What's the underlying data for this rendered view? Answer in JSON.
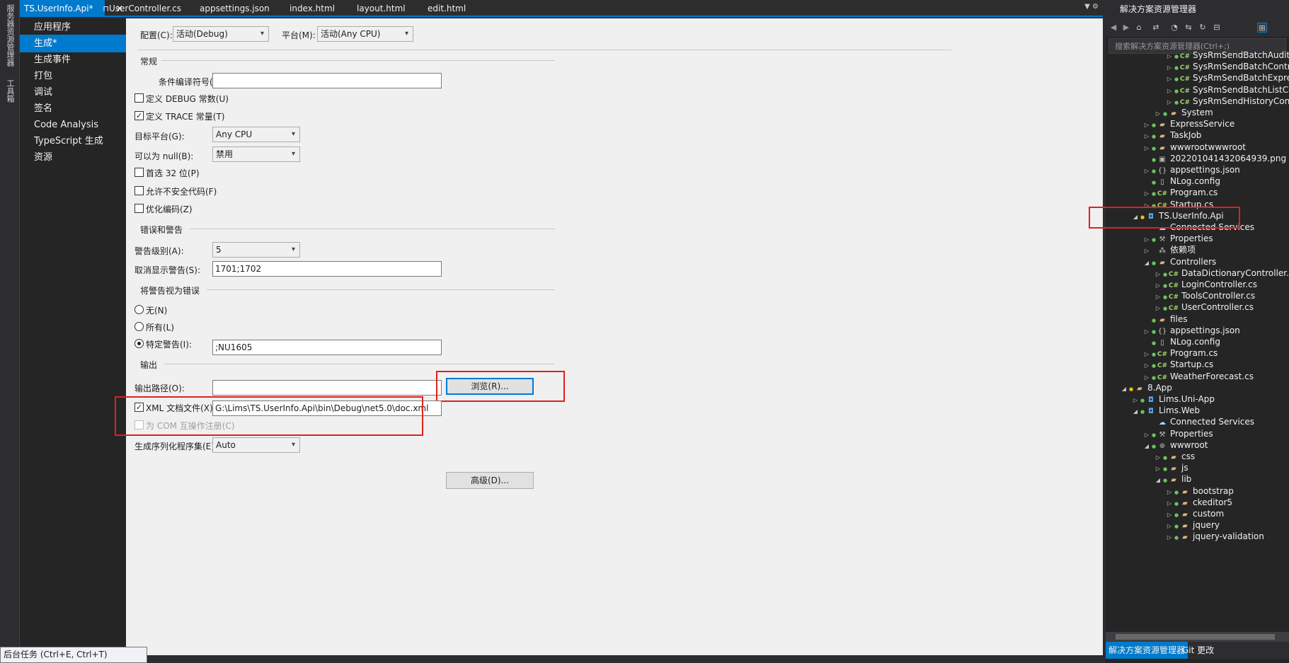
{
  "left_strip": {
    "items": [
      "服务器资源管理器",
      "工具箱"
    ]
  },
  "tabs": [
    {
      "label": "TS.UserInfo.Api*",
      "active": true,
      "pin": "⊓",
      "close": "✕"
    },
    {
      "label": "UserController.cs"
    },
    {
      "label": "appsettings.json"
    },
    {
      "label": "index.html"
    },
    {
      "label": "layout.html"
    },
    {
      "label": "edit.html"
    }
  ],
  "nav": {
    "items": [
      "应用程序",
      "生成*",
      "生成事件",
      "打包",
      "调试",
      "签名",
      "Code Analysis",
      "TypeScript 生成",
      "资源"
    ],
    "selected_index": 1
  },
  "config": {
    "label": "配置(C):",
    "value": "活动(Debug)",
    "platform_label": "平台(M):",
    "platform_value": "活动(Any CPU)"
  },
  "general": {
    "section": "常规",
    "conditional_label": "条件编译符号(Y):",
    "conditional_value": "",
    "define_debug": {
      "label": "定义 DEBUG 常数(U)",
      "checked": false
    },
    "define_trace": {
      "label": "定义 TRACE 常量(T)",
      "checked": true
    },
    "target_label": "目标平台(G):",
    "target_value": "Any CPU",
    "nullable_label": "可以为 null(B):",
    "nullable_value": "禁用",
    "prefer32": {
      "label": "首选 32 位(P)",
      "checked": false
    },
    "unsafe": {
      "label": "允许不安全代码(F)",
      "checked": false
    },
    "optimize": {
      "label": "优化编码(Z)",
      "checked": false
    }
  },
  "errors": {
    "section": "错误和警告",
    "level_label": "警告级别(A):",
    "level_value": "5",
    "suppress_label": "取消显示警告(S):",
    "suppress_value": "1701;1702"
  },
  "treat": {
    "section": "将警告视为错误",
    "none_label": "无(N)",
    "all_label": "所有(L)",
    "specific_label": "特定警告(I):",
    "specific_value": ";NU1605",
    "selected": "specific"
  },
  "output": {
    "section": "输出",
    "path_label": "输出路径(O):",
    "path_value": "",
    "browse_label": "浏览(R)...",
    "xml_label": "XML 文档文件(X):",
    "xml_checked": true,
    "xml_value": "G:\\Lims\\TS.UserInfo.Api\\bin\\Debug\\net5.0\\doc.xml",
    "com_label": "为 COM 互操作注册(C)",
    "com_checked": false,
    "serialization_label": "生成序列化程序集(E):",
    "serialization_value": "Auto",
    "advanced_label": "高级(D)..."
  },
  "solution_explorer": {
    "title": "解决方案资源管理器",
    "search_placeholder": "搜索解决方案资源管理器(Ctrl+;)",
    "tree": [
      {
        "text": "SysRmSendBatchAuditCo",
        "indent": 4,
        "icon": "cs",
        "expander": "right",
        "status": "g"
      },
      {
        "text": "SysRmSendBatchControl",
        "indent": 4,
        "icon": "cs",
        "expander": "right",
        "status": "g"
      },
      {
        "text": "SysRmSendBatchExpress",
        "indent": 4,
        "icon": "cs",
        "expander": "right",
        "status": "g"
      },
      {
        "text": "SysRmSendBatchListCont",
        "indent": 4,
        "icon": "cs",
        "expander": "right",
        "status": "g"
      },
      {
        "text": "SysRmSendHistoryContro",
        "indent": 4,
        "icon": "cs",
        "expander": "right",
        "status": "g"
      },
      {
        "text": "System",
        "indent": 3,
        "icon": "folder",
        "expander": "right",
        "status": "g"
      },
      {
        "text": "ExpressService",
        "indent": 2,
        "icon": "folder",
        "expander": "right",
        "status": "g"
      },
      {
        "text": "TaskJob",
        "indent": 2,
        "icon": "folder",
        "expander": "right",
        "status": "g"
      },
      {
        "text": "wwwrootwwwroot",
        "indent": 2,
        "icon": "folder",
        "expander": "right",
        "status": "g"
      },
      {
        "text": "202201041432064939.png",
        "indent": 2,
        "icon": "img",
        "expander": "",
        "status": "g"
      },
      {
        "text": "appsettings.json",
        "indent": 2,
        "icon": "json",
        "expander": "right",
        "status": "g"
      },
      {
        "text": "NLog.config",
        "indent": 2,
        "icon": "cfg",
        "expander": "",
        "status": "g"
      },
      {
        "text": "Program.cs",
        "indent": 2,
        "icon": "cs",
        "expander": "right",
        "status": "g"
      },
      {
        "text": "Startup.cs",
        "indent": 2,
        "icon": "cs",
        "expander": "right",
        "status": "g"
      },
      {
        "text": "TS.UserInfo.Api",
        "indent": 1,
        "icon": "proj",
        "expander": "down",
        "status": "y"
      },
      {
        "text": "Connected Services",
        "indent": 2,
        "icon": "svc",
        "expander": "",
        "status": ""
      },
      {
        "text": "Properties",
        "indent": 2,
        "icon": "wrench",
        "expander": "right",
        "status": "g"
      },
      {
        "text": "依赖项",
        "indent": 2,
        "icon": "dep",
        "expander": "right",
        "status": ""
      },
      {
        "text": "Controllers",
        "indent": 2,
        "icon": "folder",
        "expander": "down",
        "status": "g"
      },
      {
        "text": "DataDictionaryController.cs",
        "indent": 3,
        "icon": "cs",
        "expander": "right",
        "status": "g"
      },
      {
        "text": "LoginController.cs",
        "indent": 3,
        "icon": "cs",
        "expander": "right",
        "status": "g"
      },
      {
        "text": "ToolsController.cs",
        "indent": 3,
        "icon": "cs",
        "expander": "right",
        "status": "g"
      },
      {
        "text": "UserController.cs",
        "indent": 3,
        "icon": "cs",
        "expander": "right",
        "status": "g"
      },
      {
        "text": "files",
        "indent": 2,
        "icon": "folder",
        "expander": "",
        "status": "g"
      },
      {
        "text": "appsettings.json",
        "indent": 2,
        "icon": "json",
        "expander": "right",
        "status": "g"
      },
      {
        "text": "NLog.config",
        "indent": 2,
        "icon": "cfg",
        "expander": "",
        "status": "g"
      },
      {
        "text": "Program.cs",
        "indent": 2,
        "icon": "cs",
        "expander": "right",
        "status": "g"
      },
      {
        "text": "Startup.cs",
        "indent": 2,
        "icon": "cs",
        "expander": "right",
        "status": "g"
      },
      {
        "text": "WeatherForecast.cs",
        "indent": 2,
        "icon": "cs",
        "expander": "right",
        "status": "g"
      },
      {
        "text": "8.App",
        "indent": 0,
        "icon": "folder",
        "expander": "down",
        "status": "y"
      },
      {
        "text": "Lims.Uni-App",
        "indent": 1,
        "icon": "proj",
        "expander": "right",
        "status": "g"
      },
      {
        "text": "Lims.Web",
        "indent": 1,
        "icon": "proj",
        "expander": "down",
        "status": "g"
      },
      {
        "text": "Connected Services",
        "indent": 2,
        "icon": "svc",
        "expander": "",
        "status": ""
      },
      {
        "text": "Properties",
        "indent": 2,
        "icon": "wrench",
        "expander": "right",
        "status": "g"
      },
      {
        "text": "wwwroot",
        "indent": 2,
        "icon": "globe",
        "expander": "down",
        "status": "g"
      },
      {
        "text": "css",
        "indent": 3,
        "icon": "folder",
        "expander": "right",
        "status": "g"
      },
      {
        "text": "js",
        "indent": 3,
        "icon": "folder",
        "expander": "right",
        "status": "g"
      },
      {
        "text": "lib",
        "indent": 3,
        "icon": "folder",
        "expander": "down",
        "status": "g"
      },
      {
        "text": "bootstrap",
        "indent": 4,
        "icon": "folder",
        "expander": "right",
        "status": "g"
      },
      {
        "text": "ckeditor5",
        "indent": 4,
        "icon": "folder",
        "expander": "right",
        "status": "g"
      },
      {
        "text": "custom",
        "indent": 4,
        "icon": "folder",
        "expander": "right",
        "status": "g"
      },
      {
        "text": "jquery",
        "indent": 4,
        "icon": "folder",
        "expander": "right",
        "status": "g"
      },
      {
        "text": "jquery-validation",
        "indent": 4,
        "icon": "folder",
        "expander": "right",
        "status": "g"
      }
    ],
    "bottom_tabs": [
      "解决方案资源管理器",
      "Git 更改"
    ]
  },
  "status_tooltip": "后台任务 (Ctrl+E, Ctrl+T)",
  "colors": {
    "accent": "#007acc",
    "highlight": "#e02020"
  }
}
